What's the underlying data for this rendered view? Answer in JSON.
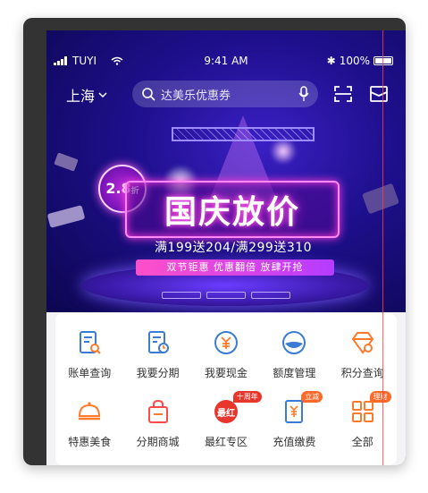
{
  "status_bar": {
    "carrier": "TUYI",
    "time": "9:41 AM",
    "battery": "100%"
  },
  "top_bar": {
    "city": "上海",
    "search_placeholder": "达美乐优惠券"
  },
  "banner": {
    "discount_badge": "2.8",
    "discount_unit": "折",
    "title": "国庆放价",
    "promo_line": "满199送204/满299送310",
    "sub_promo": "双节钜惠 优惠翻倍 放肆开抢"
  },
  "quick_menu": {
    "items": [
      {
        "label": "账单查询",
        "icon": "bill-search-icon",
        "color": "#3a7bd5"
      },
      {
        "label": "我要分期",
        "icon": "installment-icon",
        "color": "#3a7bd5"
      },
      {
        "label": "我要现金",
        "icon": "cash-icon",
        "color": "#3a7bd5"
      },
      {
        "label": "额度管理",
        "icon": "limit-icon",
        "color": "#3a7bd5"
      },
      {
        "label": "积分查询",
        "icon": "points-icon",
        "color": "#ff7a2a"
      },
      {
        "label": "特惠美食",
        "icon": "food-icon",
        "color": "#ff7a2a"
      },
      {
        "label": "分期商城",
        "icon": "mall-icon",
        "color": "#ff4a4a"
      },
      {
        "label": "最红专区",
        "icon": "hot-zone-icon",
        "color": "#e8362d",
        "badge": "十周年",
        "icon_text": "最红"
      },
      {
        "label": "充值缴费",
        "icon": "recharge-icon",
        "color": "#3a7bd5",
        "badge": "立减"
      },
      {
        "label": "全部",
        "icon": "all-icon",
        "color": "#ff7a2a",
        "badge": "理财"
      }
    ]
  },
  "colors": {
    "accent_blue": "#3a7bd5",
    "accent_orange": "#ff7a2a",
    "hero_bg": "#1d0f8a"
  }
}
